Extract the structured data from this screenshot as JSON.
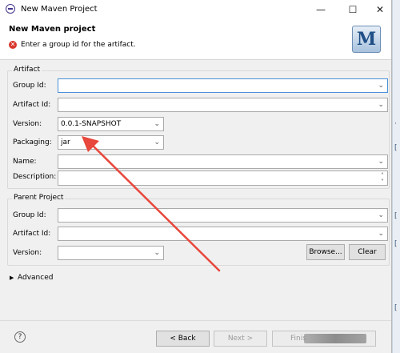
{
  "window": {
    "title": "New Maven Project",
    "controls": [
      "—",
      "☐",
      "✕"
    ]
  },
  "header": {
    "title": "New Maven project",
    "message": "Enter a group id for the artifact.",
    "logo_letter": "M"
  },
  "artifact": {
    "section_title": "Artifact",
    "group_id": {
      "label": "Group Id:",
      "value": ""
    },
    "artifact_id": {
      "label": "Artifact Id:",
      "value": ""
    },
    "version": {
      "label": "Version:",
      "value": "0.0.1-SNAPSHOT"
    },
    "packaging": {
      "label": "Packaging:",
      "value": "jar"
    },
    "name": {
      "label": "Name:",
      "value": ""
    },
    "description": {
      "label": "Description:",
      "value": ""
    }
  },
  "parent": {
    "section_title": "Parent Project",
    "group_id": {
      "label": "Group Id:",
      "value": ""
    },
    "artifact_id": {
      "label": "Artifact Id:",
      "value": ""
    },
    "version": {
      "label": "Version:",
      "value": ""
    },
    "browse_label": "Browse...",
    "clear_label": "Clear"
  },
  "advanced": {
    "label": "Advanced"
  },
  "footer": {
    "help": "?",
    "back_label": "< Back",
    "next_label": "Next >",
    "finish_label": "Finis"
  },
  "colors": {
    "annotation_arrow": "#e8473b",
    "error": "#d9362b",
    "focus_border": "#4a90d9"
  }
}
